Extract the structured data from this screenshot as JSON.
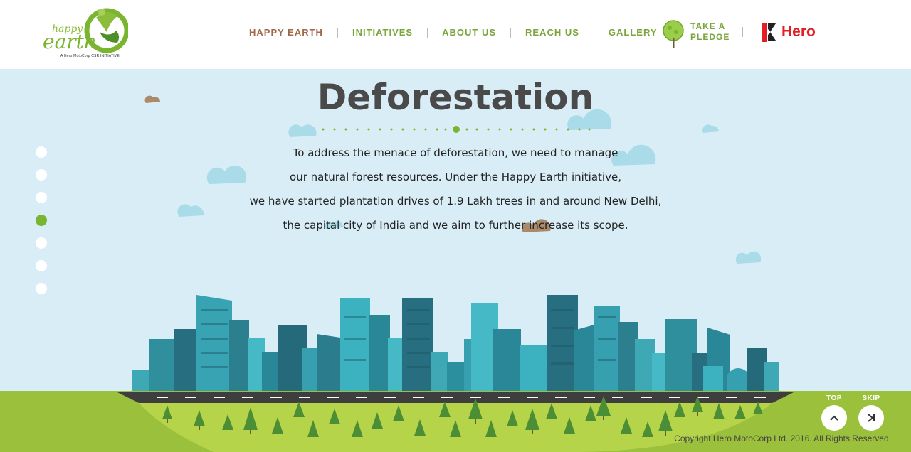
{
  "logo": {
    "happy": "happy",
    "earth": "earth",
    "tagline": "A Hero MotoCorp CSR INITIATIVE"
  },
  "nav": {
    "items": [
      {
        "label": "HAPPY EARTH",
        "active": true
      },
      {
        "label": "INITIATIVES",
        "active": false
      },
      {
        "label": "ABOUT US",
        "active": false
      },
      {
        "label": "REACH US",
        "active": false
      },
      {
        "label": "GALLERY",
        "active": false
      }
    ],
    "pledge_line1": "TAKE A",
    "pledge_line2": "PLEDGE"
  },
  "brand": {
    "name": "Hero",
    "color": "#e31f26"
  },
  "main": {
    "title": "Deforestation",
    "description": [
      "To address the menace of deforestation, we need to manage",
      "our natural forest resources. Under the Happy Earth initiative,",
      "we have started plantation drives of 1.9 Lakh trees in and around New Delhi,",
      "the capital city of India and we aim to further increase its scope."
    ]
  },
  "pager": {
    "count": 7,
    "active_index": 3
  },
  "controls": {
    "top_label": "TOP",
    "skip_label": "SKIP"
  },
  "footer": {
    "copyright": "Copyright Hero MotoCorp Ltd. 2016. All Rights Reserved."
  },
  "colors": {
    "accent_green": "#7ab52f",
    "nav_active": "#a0694a",
    "sky": "#d9edf7",
    "grass": "#9bc13c"
  }
}
